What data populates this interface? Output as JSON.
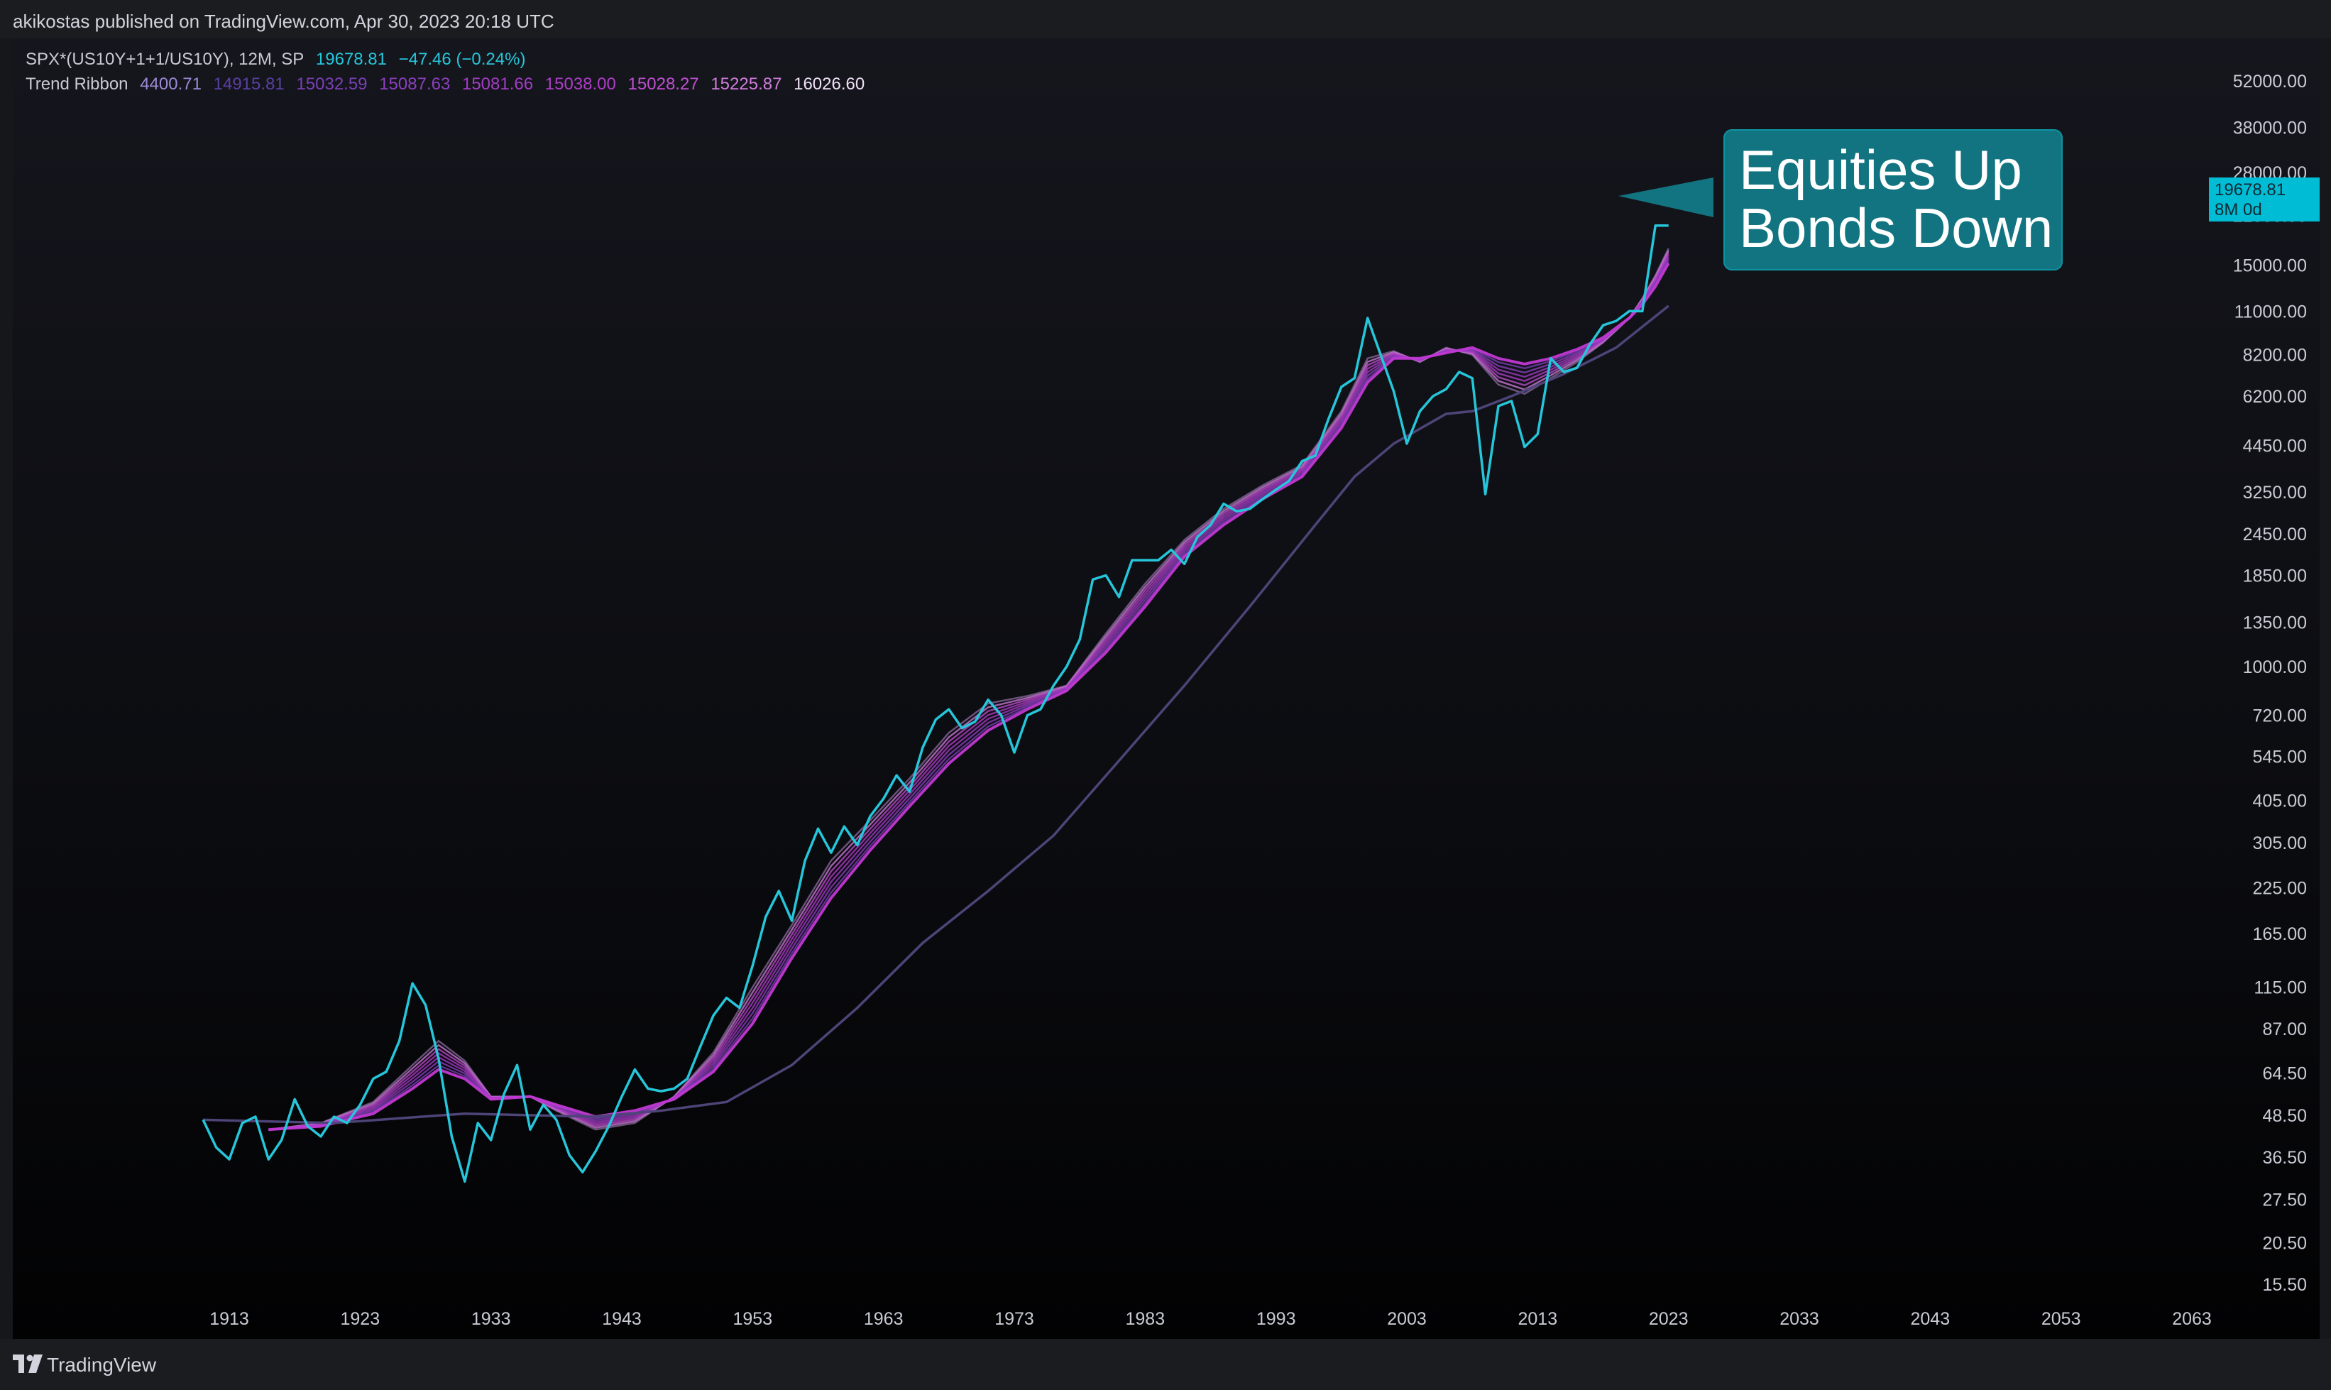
{
  "header": {
    "published_text": "akikostas published on TradingView.com, Apr 30, 2023 20:18 UTC"
  },
  "legend": {
    "main": {
      "symbol": "SPX*(US10Y+1+1/US10Y), 12M, SP",
      "value": "19678.81",
      "change": "−47.46 (−0.24%)",
      "color": "#26c6da"
    },
    "ribbon": {
      "name": "Trend Ribbon",
      "values": [
        "4400.71",
        "14915.81",
        "15032.59",
        "15087.63",
        "15081.66",
        "15038.00",
        "15028.27",
        "15225.87",
        "16026.60"
      ],
      "colors": [
        "#9c8ad6",
        "#5b3fa4",
        "#7b40b8",
        "#8e3fc0",
        "#a33cc6",
        "#b03dc9",
        "#c04fd2",
        "#d07ddc",
        "#efe0f6"
      ]
    }
  },
  "price_tag": {
    "value": "19678.81",
    "countdown": "8M 0d"
  },
  "callout": {
    "line1": "Equities Up",
    "line2": "Bonds Down"
  },
  "footer": {
    "brand": "TradingView"
  },
  "chart_data": {
    "type": "line",
    "scale": "log",
    "ylim": [
      13,
      60000
    ],
    "xlim": [
      1903.5,
      2073.5
    ],
    "y_ticks": [
      "52000.00",
      "38000.00",
      "28000.00",
      "21000.00",
      "15000.00",
      "11000.00",
      "8200.00",
      "6200.00",
      "4450.00",
      "3250.00",
      "2450.00",
      "1850.00",
      "1350.00",
      "1000.00",
      "720.00",
      "545.00",
      "405.00",
      "305.00",
      "225.00",
      "165.00",
      "115.00",
      "87.00",
      "64.50",
      "48.50",
      "36.50",
      "27.50",
      "20.50",
      "15.50"
    ],
    "x_ticks": [
      "1913",
      "1923",
      "1933",
      "1943",
      "1953",
      "1963",
      "1973",
      "1983",
      "1993",
      "2003",
      "2013",
      "2023",
      "2033",
      "2043",
      "2053",
      "2063"
    ],
    "colors": {
      "price": "#26c6da",
      "long_ma": "#4e4478",
      "ribbon_inner": "#c138d2",
      "ribbon_outer": "#8a6a9e"
    },
    "series": [
      {
        "x": [
          1911,
          1912,
          1913,
          1914,
          1915,
          1916,
          1917,
          1918,
          1919,
          1920,
          1921,
          1922,
          1923,
          1924,
          1925,
          1926,
          1927,
          1928,
          1929,
          1930,
          1931,
          1932,
          1933,
          1934,
          1935,
          1936,
          1937,
          1938,
          1939,
          1940,
          1941,
          1942,
          1943,
          1944,
          1945,
          1946,
          1947,
          1948,
          1949,
          1950,
          1951,
          1952,
          1953,
          1954,
          1955,
          1956,
          1957,
          1958,
          1959,
          1960,
          1961,
          1962,
          1963,
          1964,
          1965,
          1966,
          1967,
          1968,
          1969,
          1970,
          1971,
          1972,
          1973,
          1974,
          1975,
          1976,
          1977,
          1978,
          1979,
          1980,
          1981,
          1982,
          1983,
          1984,
          1985,
          1986,
          1987,
          1988,
          1989,
          1990,
          1991,
          1992,
          1993,
          1994,
          1995,
          1996,
          1997,
          1998,
          1999,
          2000,
          2001,
          2002,
          2003,
          2004,
          2005,
          2006,
          2007,
          2008,
          2009,
          2010,
          2011,
          2012,
          2013,
          2014,
          2015,
          2016,
          2017,
          2018,
          2019,
          2020,
          2021,
          2022,
          2023
        ],
        "y": [
          47,
          39,
          36,
          46,
          48,
          36,
          41,
          54,
          45,
          42,
          48,
          46,
          52,
          62,
          65,
          80,
          118,
          102,
          71,
          42,
          31,
          46,
          41,
          56,
          68,
          44,
          52,
          47,
          37,
          33,
          38,
          45,
          55,
          66,
          58,
          57,
          58,
          62,
          77,
          95,
          107,
          100,
          133,
          185,
          220,
          180,
          270,
          335,
          285,
          340,
          300,
          365,
          410,
          480,
          430,
          580,
          700,
          750,
          660,
          690,
          800,
          720,
          560,
          720,
          750,
          880,
          1000,
          1200,
          1800,
          1850,
          1600,
          2050,
          2050,
          2050,
          2200,
          2000,
          2400,
          2600,
          3000,
          2850,
          2900,
          3100,
          3300,
          3500,
          4000,
          4150,
          5300,
          6600,
          7000,
          10500,
          8200,
          6400,
          4500,
          5600,
          6200,
          6500,
          7300,
          7000,
          3200,
          5800,
          6000,
          4400,
          4800,
          8000,
          7300,
          7500,
          8800,
          10000,
          10300,
          11000,
          11000,
          19600,
          19600
        ]
      },
      {
        "x": [
          1911,
          1921,
          1931,
          1941,
          1946,
          1951,
          1956,
          1961,
          1966,
          1971,
          1976,
          1981,
          1986,
          1991,
          1996,
          1999,
          2002,
          2006,
          2008,
          2011,
          2015,
          2019,
          2023
        ],
        "y": [
          47,
          46,
          49,
          48,
          50,
          53,
          68,
          100,
          155,
          220,
          320,
          530,
          880,
          1500,
          2600,
          3600,
          4500,
          5500,
          5600,
          6200,
          7200,
          8600,
          11400
        ]
      },
      {
        "x": [
          1916,
          1920,
          1924,
          1927,
          1929,
          1931,
          1933,
          1936,
          1938,
          1941,
          1944,
          1947,
          1950,
          1953,
          1956,
          1959,
          1962,
          1965,
          1968,
          1971,
          1974,
          1977,
          1980,
          1983,
          1986,
          1989,
          1992,
          1995,
          1998,
          2000,
          2002,
          2004,
          2006,
          2008,
          2010,
          2012,
          2014,
          2016,
          2018,
          2020,
          2021,
          2022,
          2023
        ],
        "y": [
          44,
          45,
          49,
          58,
          66,
          62,
          54,
          55,
          52,
          48,
          50,
          54,
          65,
          90,
          140,
          210,
          290,
          390,
          520,
          650,
          750,
          850,
          1100,
          1500,
          2100,
          2600,
          3100,
          3600,
          5000,
          6800,
          8000,
          8000,
          8300,
          8600,
          8000,
          7700,
          8000,
          8500,
          9200,
          10500,
          11500,
          13000,
          15200
        ]
      },
      {
        "x": [
          1916,
          1920,
          1924,
          1927,
          1929,
          1931,
          1933,
          1936,
          1938,
          1941,
          1944,
          1947,
          1950,
          1953,
          1956,
          1959,
          1962,
          1965,
          1968,
          1971,
          1974,
          1977,
          1980,
          1983,
          1986,
          1989,
          1992,
          1995,
          1998,
          2000,
          2002,
          2004,
          2006,
          2008,
          2010,
          2012,
          2014,
          2016,
          2018,
          2020,
          2021,
          2022,
          2023
        ],
        "y": [
          44,
          46,
          53,
          68,
          80,
          70,
          55,
          55,
          50,
          44,
          46,
          55,
          74,
          115,
          175,
          270,
          355,
          470,
          640,
          780,
          820,
          880,
          1250,
          1750,
          2350,
          2900,
          3400,
          3900,
          5600,
          8000,
          8400,
          7800,
          8600,
          8200,
          6700,
          6300,
          7000,
          7800,
          8900,
          10500,
          12000,
          14000,
          16800
        ]
      }
    ]
  }
}
